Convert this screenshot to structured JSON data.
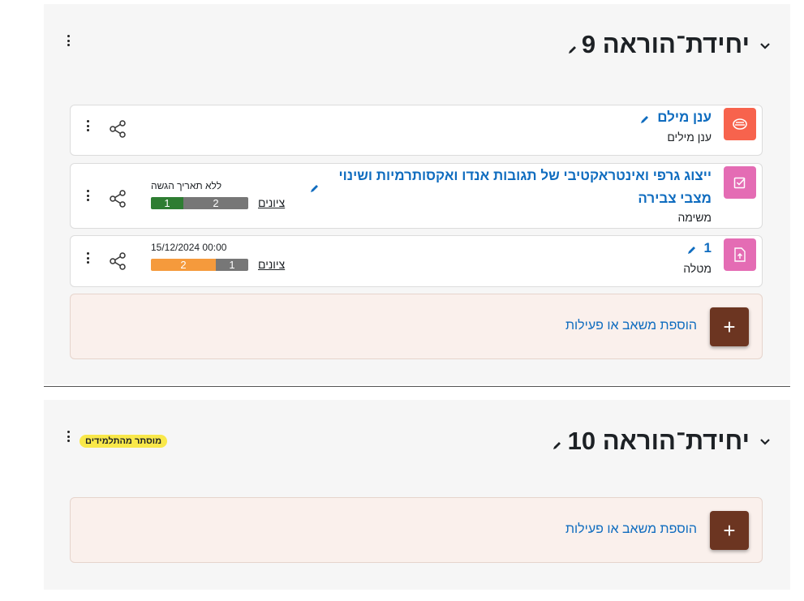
{
  "colors": {
    "section_bg": "#f6f6f6",
    "link": "#0f6cbf",
    "add_button": "#6c3521",
    "add_box_bg": "#faf0ec",
    "wordcloud_icon": "#f7634d",
    "assignment_icon": "#e46cb4",
    "hidden_badge": "#f9e84a",
    "bar_green": "#2e7d32",
    "bar_grey": "#777777",
    "bar_orange": "#f59a3c"
  },
  "section9": {
    "title": "יחידת־הוראה 9",
    "activities": [
      {
        "name": "ענן מילם",
        "type": "ענן מילים",
        "icon": "wordcloud-icon"
      },
      {
        "name": "ייצוג גרפי ואינטראקטיבי של תגובות אנדו ואקסותרמיות ושינוי מצבי צבירה",
        "type": "משימה",
        "icon": "assignment-check-icon",
        "date_text": "ללא תאריך הגשה",
        "grades_label": "ציונים",
        "bar": {
          "left_value": "1",
          "right_value": "2"
        }
      },
      {
        "name": "1",
        "type": "מטלה",
        "icon": "file-upload-icon",
        "date_text": "15/12/2024 00:00",
        "grades_label": "ציונים",
        "bar": {
          "left_value": "2",
          "right_value": "1"
        }
      }
    ],
    "add_label": "הוספת משאב או פעילות",
    "add_symbol": "+"
  },
  "section10": {
    "title": "יחידת־הוראה 10",
    "hidden_badge": "מוסתר מהתלמידים",
    "add_label": "הוספת משאב או פעילות",
    "add_symbol": "+"
  }
}
